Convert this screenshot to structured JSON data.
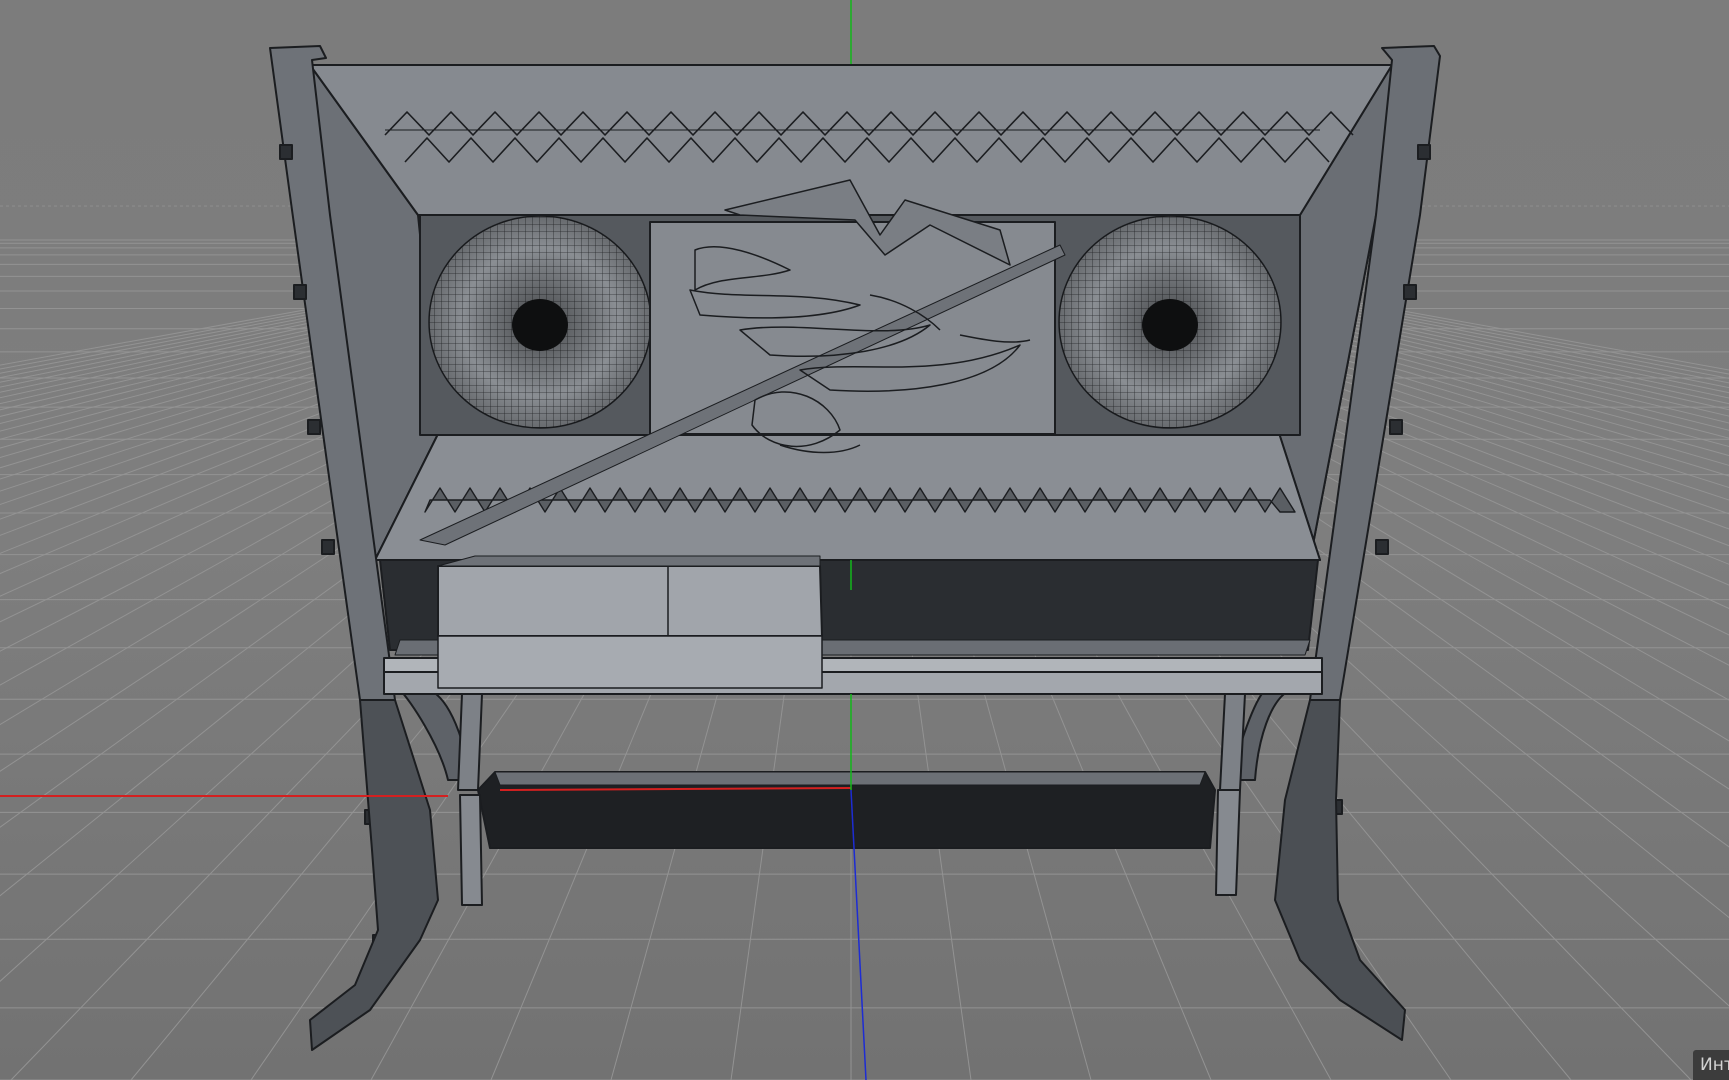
{
  "viewport": {
    "mode_badge": "Инте"
  },
  "colors": {
    "background": "#7b7b7b",
    "grid_line": "#939393",
    "axis_x": "#d42020",
    "axis_y": "#12b81a",
    "axis_z": "#1d2cd4",
    "model_face": "#7d8187",
    "model_edge": "#1b1d20",
    "badge_bg": "#3c3c3c"
  }
}
